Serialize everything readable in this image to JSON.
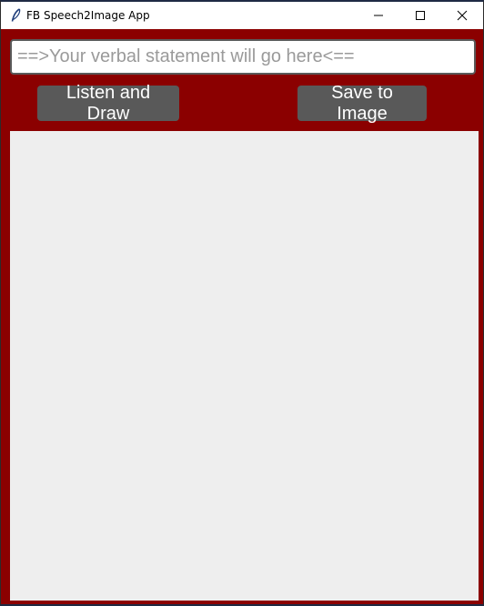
{
  "window": {
    "title": "FB Speech2Image App",
    "app_icon": "feather-icon",
    "controls": {
      "minimize_icon": "minimize-icon",
      "maximize_icon": "maximize-icon",
      "close_icon": "close-icon"
    }
  },
  "statement": {
    "placeholder": "==>Your verbal statement will go here<==",
    "value": ""
  },
  "buttons": {
    "listen_label": "Listen and Draw",
    "save_label": "Save to Image"
  },
  "colors": {
    "background": "#8b0000",
    "button": "#595959",
    "canvas": "#eeeeee",
    "placeholder_text": "#9a9a9a"
  }
}
